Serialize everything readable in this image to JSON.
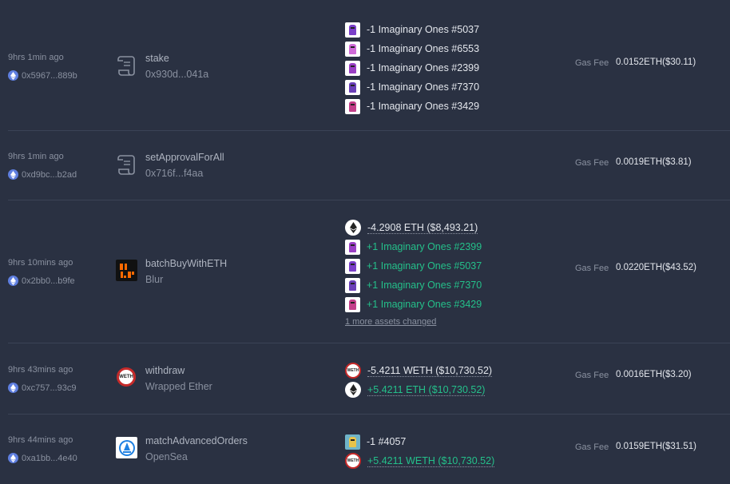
{
  "transactions": [
    {
      "time": "9hrs 1min ago",
      "from": "0x5967...889b",
      "method": "stake",
      "contract": "0x930d...041a",
      "contract_icon": "scroll-icon",
      "changes": [
        {
          "text": "-1 Imaginary Ones #5037",
          "kind": "neg"
        },
        {
          "text": "-1 Imaginary Ones #6553",
          "kind": "neg"
        },
        {
          "text": "-1 Imaginary Ones #2399",
          "kind": "neg"
        },
        {
          "text": "-1 Imaginary Ones #7370",
          "kind": "neg"
        },
        {
          "text": "-1 Imaginary Ones #3429",
          "kind": "neg"
        }
      ],
      "gas_label": "Gas Fee",
      "gas_value": "0.0152ETH($30.11)"
    },
    {
      "time": "9hrs 1min ago",
      "from": "0xd9bc...b2ad",
      "method": "setApprovalForAll",
      "contract": "0x716f...f4aa",
      "contract_icon": "scroll-icon",
      "changes": [],
      "gas_label": "Gas Fee",
      "gas_value": "0.0019ETH($3.81)"
    },
    {
      "time": "9hrs 10mins ago",
      "from": "0x2bb0...b9fe",
      "method": "batchBuyWithETH",
      "contract": "Blur",
      "contract_icon": "blur-logo-icon",
      "changes": [
        {
          "text": "-4.2908 ETH ($8,493.21)",
          "kind": "neg"
        },
        {
          "text": "+1 Imaginary Ones #2399",
          "kind": "pos"
        },
        {
          "text": "+1 Imaginary Ones #5037",
          "kind": "pos"
        },
        {
          "text": "+1 Imaginary Ones #7370",
          "kind": "pos"
        },
        {
          "text": "+1 Imaginary Ones #3429",
          "kind": "pos"
        }
      ],
      "more": "1 more assets changed",
      "gas_label": "Gas Fee",
      "gas_value": "0.0220ETH($43.52)"
    },
    {
      "time": "9hrs 43mins ago",
      "from": "0xc757...93c9",
      "method": "withdraw",
      "contract": "Wrapped Ether",
      "contract_icon": "weth-logo-icon",
      "changes": [
        {
          "text": "-5.4211 WETH ($10,730.52)",
          "kind": "neg"
        },
        {
          "text": "+5.4211 ETH ($10,730.52)",
          "kind": "pos"
        }
      ],
      "gas_label": "Gas Fee",
      "gas_value": "0.0016ETH($3.20)"
    },
    {
      "time": "9hrs 44mins ago",
      "from": "0xa1bb...4e40",
      "method": "matchAdvancedOrders",
      "contract": "OpenSea",
      "contract_icon": "opensea-logo-icon",
      "changes": [
        {
          "text": "-1 #4057",
          "kind": "neg"
        },
        {
          "text": "+5.4211 WETH ($10,730.52)",
          "kind": "pos"
        }
      ],
      "gas_label": "Gas Fee",
      "gas_value": "0.0159ETH($31.51)"
    }
  ],
  "colors": {
    "background": "#2a3142",
    "positive": "#24c08a",
    "divider": "#3b4356",
    "eth_badge": "#5f7fe0",
    "blur_accent": "#ff6a00",
    "weth_ring": "#c62a2a",
    "opensea_blue": "#2081e2"
  }
}
